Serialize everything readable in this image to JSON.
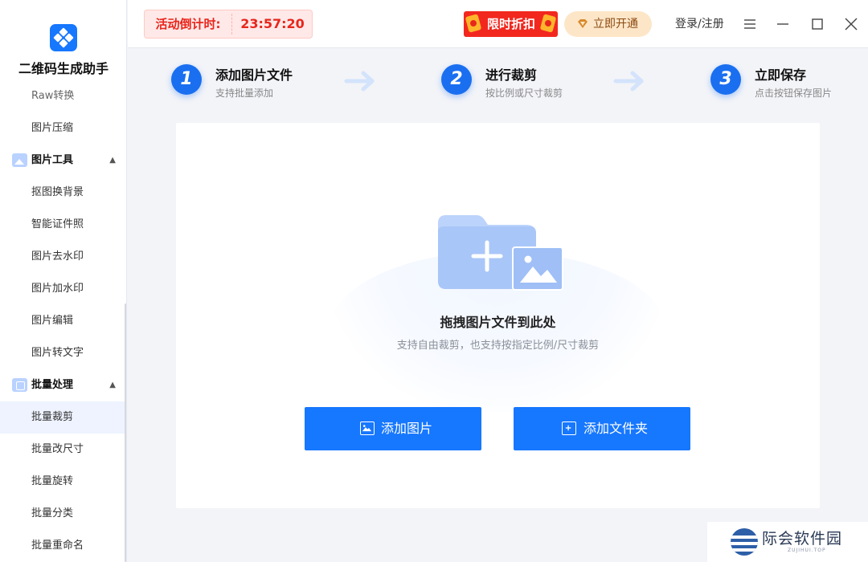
{
  "app": {
    "name": "二维码生成助手"
  },
  "sidebar": {
    "items_top": [
      {
        "label": "Raw转换"
      },
      {
        "label": "图片压缩"
      }
    ],
    "group_tools": {
      "label": "图片工具",
      "icon": "image-icon"
    },
    "tools_items": [
      {
        "label": "抠图换背景"
      },
      {
        "label": "智能证件照"
      },
      {
        "label": "图片去水印"
      },
      {
        "label": "图片加水印"
      },
      {
        "label": "图片编辑"
      },
      {
        "label": "图片转文字"
      }
    ],
    "group_batch": {
      "label": "批量处理",
      "icon": "batch-icon"
    },
    "batch_items": [
      {
        "label": "批量裁剪",
        "active": true
      },
      {
        "label": "批量改尺寸"
      },
      {
        "label": "批量旋转"
      },
      {
        "label": "批量分类"
      },
      {
        "label": "批量重命名"
      }
    ]
  },
  "topbar": {
    "countdown_label": "活动倒计时:",
    "countdown_time": "23:57:20",
    "promo_label": "限时折扣",
    "vip_label": "立即开通",
    "login_label": "登录/注册"
  },
  "steps": [
    {
      "num": "1",
      "title": "添加图片文件",
      "sub": "支持批量添加"
    },
    {
      "num": "2",
      "title": "进行裁剪",
      "sub": "按比例或尺寸裁剪"
    },
    {
      "num": "3",
      "title": "立即保存",
      "sub": "点击按钮保存图片"
    }
  ],
  "dropzone": {
    "title": "拖拽图片文件到此处",
    "subtitle": "支持自由裁剪，也支持按指定比例/尺寸裁剪"
  },
  "buttons": {
    "add_image": "添加图片",
    "add_folder": "添加文件夹"
  },
  "watermark": {
    "title": "际会软件园",
    "sub": "ZUJIHUI.TOP"
  },
  "colors": {
    "primary": "#1677ff",
    "promo": "#f2281f",
    "countdown": "#e8261c",
    "vip_bg": "#fde6c8"
  }
}
